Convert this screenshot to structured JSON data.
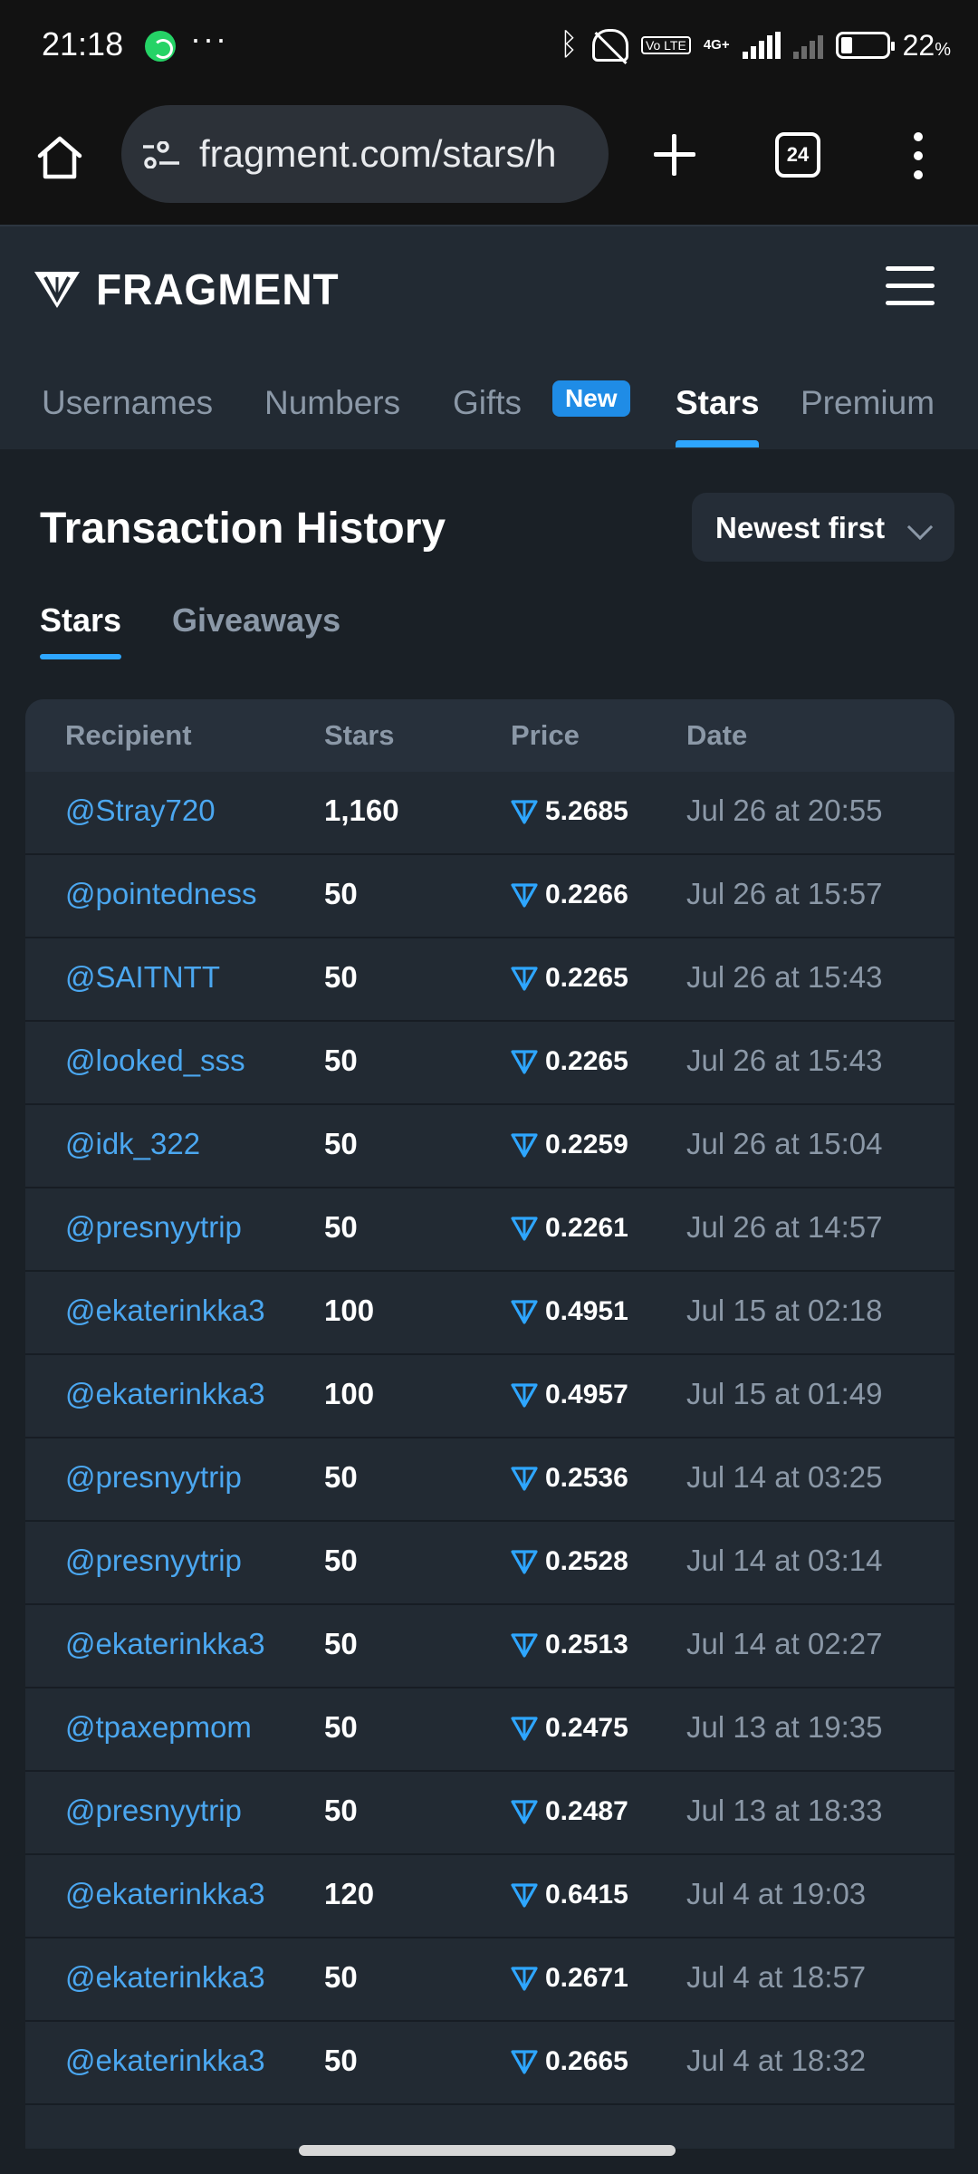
{
  "status_bar": {
    "time": "21:18",
    "more": "···",
    "network": "4G+",
    "volte": "Vo LTE",
    "battery": "22",
    "battery_unit": "%"
  },
  "browser": {
    "url": "fragment.com/stars/h",
    "tab_count": "24"
  },
  "site": {
    "logo_text": "FRAGMENT",
    "nav": [
      {
        "label": "Usernames"
      },
      {
        "label": "Numbers"
      },
      {
        "label": "Gifts"
      },
      {
        "label": "Stars"
      },
      {
        "label": "Premium"
      }
    ],
    "new_badge": "New"
  },
  "main": {
    "title": "Transaction History",
    "sort_label": "Newest first",
    "subtabs": [
      {
        "label": "Stars"
      },
      {
        "label": "Giveaways"
      }
    ],
    "columns": [
      "Recipient",
      "Stars",
      "Price",
      "Date"
    ],
    "rows": [
      {
        "recipient": "@Stray720",
        "stars": "1,160",
        "price": "5.2685",
        "date": "Jul 26 at 20:55"
      },
      {
        "recipient": "@pointedness",
        "stars": "50",
        "price": "0.2266",
        "date": "Jul 26 at 15:57"
      },
      {
        "recipient": "@SAITNTT",
        "stars": "50",
        "price": "0.2265",
        "date": "Jul 26 at 15:43"
      },
      {
        "recipient": "@looked_sss",
        "stars": "50",
        "price": "0.2265",
        "date": "Jul 26 at 15:43"
      },
      {
        "recipient": "@idk_322",
        "stars": "50",
        "price": "0.2259",
        "date": "Jul 26 at 15:04"
      },
      {
        "recipient": "@presnyytrip",
        "stars": "50",
        "price": "0.2261",
        "date": "Jul 26 at 14:57"
      },
      {
        "recipient": "@ekaterinkka3",
        "stars": "100",
        "price": "0.4951",
        "date": "Jul 15 at 02:18"
      },
      {
        "recipient": "@ekaterinkka3",
        "stars": "100",
        "price": "0.4957",
        "date": "Jul 15 at 01:49"
      },
      {
        "recipient": "@presnyytrip",
        "stars": "50",
        "price": "0.2536",
        "date": "Jul 14 at 03:25"
      },
      {
        "recipient": "@presnyytrip",
        "stars": "50",
        "price": "0.2528",
        "date": "Jul 14 at 03:14"
      },
      {
        "recipient": "@ekaterinkka3",
        "stars": "50",
        "price": "0.2513",
        "date": "Jul 14 at 02:27"
      },
      {
        "recipient": "@tpaxepmom",
        "stars": "50",
        "price": "0.2475",
        "date": "Jul 13 at 19:35"
      },
      {
        "recipient": "@presnyytrip",
        "stars": "50",
        "price": "0.2487",
        "date": "Jul 13 at 18:33"
      },
      {
        "recipient": "@ekaterinkka3",
        "stars": "120",
        "price": "0.6415",
        "date": "Jul 4 at 19:03"
      },
      {
        "recipient": "@ekaterinkka3",
        "stars": "50",
        "price": "0.2671",
        "date": "Jul 4 at 18:57"
      },
      {
        "recipient": "@ekaterinkka3",
        "stars": "50",
        "price": "0.2665",
        "date": "Jul 4 at 18:32"
      }
    ]
  },
  "colors": {
    "accent": "#2ea6ff",
    "link": "#4ba7f0",
    "background": "#1a2026",
    "header": "#222a33",
    "muted_text": "#8b98a7"
  }
}
